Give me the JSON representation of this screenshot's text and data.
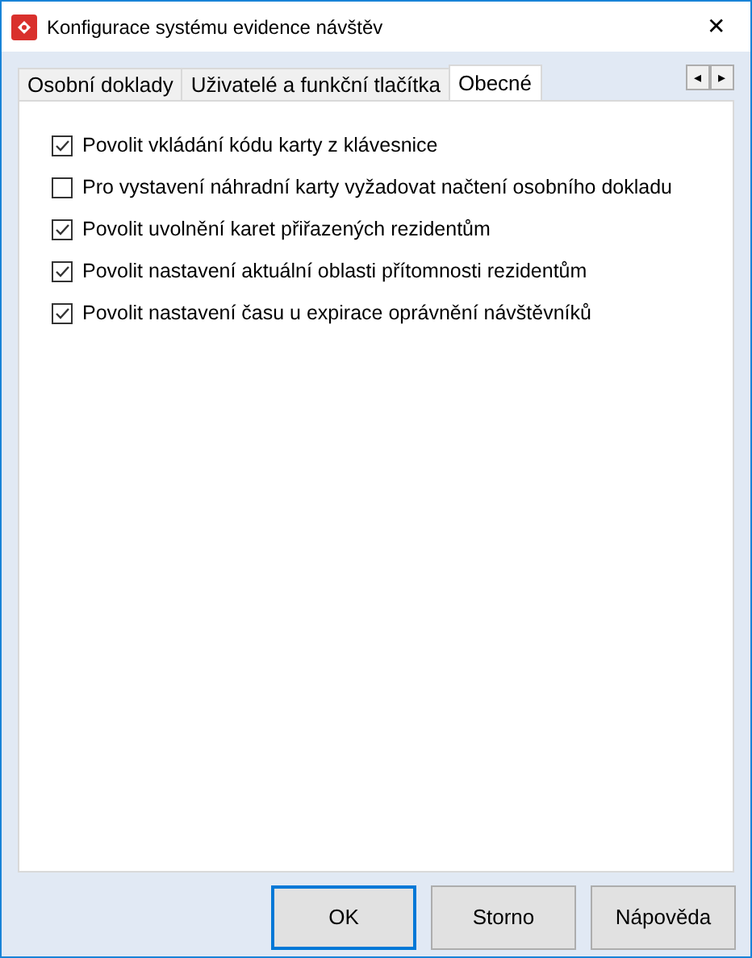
{
  "window": {
    "title": "Konfigurace systému evidence návštěv",
    "close": "✕"
  },
  "tabs": [
    {
      "label": "Osobní doklady",
      "selected": false
    },
    {
      "label": "Uživatelé a funkční tlačítka",
      "selected": false
    },
    {
      "label": "Obecné",
      "selected": true
    }
  ],
  "tab_scroll": [
    "◂",
    "▸"
  ],
  "options": [
    {
      "label": "Povolit vkládání kódu karty z klávesnice",
      "checked": true
    },
    {
      "label": "Pro vystavení náhradní karty vyžadovat načtení osobního dokladu",
      "checked": false
    },
    {
      "label": "Povolit uvolnění karet přiřazených rezidentům",
      "checked": true
    },
    {
      "label": "Povolit nastavení aktuální oblasti přítomnosti rezidentům",
      "checked": true
    },
    {
      "label": "Povolit nastavení času u expirace oprávnění návštěvníků",
      "checked": true
    }
  ],
  "buttons": [
    {
      "label": "OK",
      "default": true
    },
    {
      "label": "Storno",
      "default": false
    },
    {
      "label": "Nápověda",
      "default": false
    }
  ]
}
